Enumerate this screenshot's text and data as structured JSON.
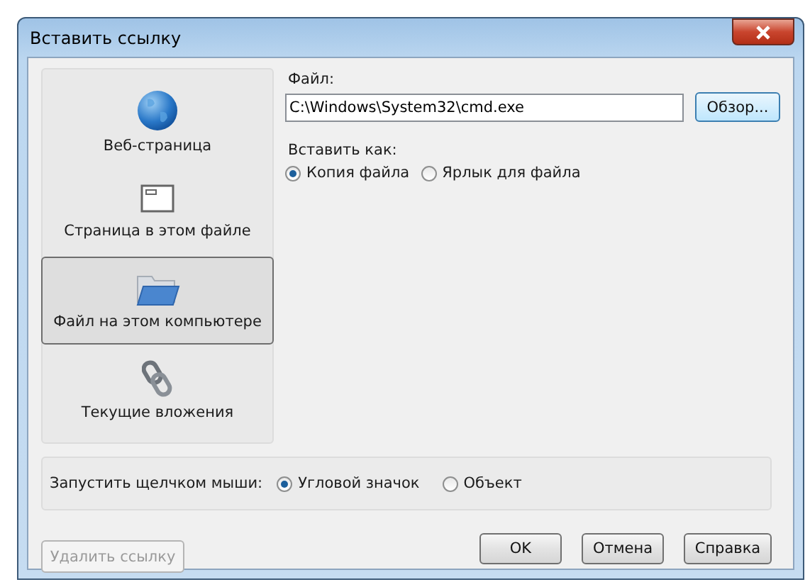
{
  "window": {
    "title": "Вставить ссылку"
  },
  "link_types": [
    {
      "label": "Веб-страница",
      "selected": false
    },
    {
      "label": "Страница в этом файле",
      "selected": false
    },
    {
      "label": "Файл на этом компьютере",
      "selected": true
    },
    {
      "label": "Текущие вложения",
      "selected": false
    }
  ],
  "file": {
    "label": "Файл:",
    "value": "C:\\Windows\\System32\\cmd.exe",
    "browse": "Обзор..."
  },
  "insert_as": {
    "label": "Вставить как:",
    "options": [
      {
        "label": "Копия файла",
        "selected": true
      },
      {
        "label": "Ярлык для файла",
        "selected": false
      }
    ]
  },
  "launch": {
    "label": "Запустить щелчком мыши:",
    "options": [
      {
        "label": "Угловой значок",
        "selected": true
      },
      {
        "label": "Объект",
        "selected": false
      }
    ]
  },
  "remove_button": {
    "label": "Удалить ссылку",
    "disabled": true
  },
  "buttons": [
    {
      "label": "OK",
      "disabled": false
    },
    {
      "label": "Отмена",
      "disabled": false
    },
    {
      "label": "Справка",
      "disabled": false
    }
  ]
}
